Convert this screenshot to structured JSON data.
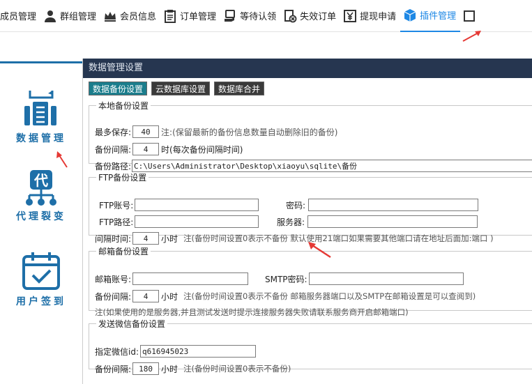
{
  "menu": [
    {
      "label": "成员管理",
      "icon": "user-icon"
    },
    {
      "label": "群组管理",
      "icon": "group-icon"
    },
    {
      "label": "会员信息",
      "icon": "crown-icon"
    },
    {
      "label": "订单管理",
      "icon": "clipboard-icon"
    },
    {
      "label": "等待认领",
      "icon": "hand-icon"
    },
    {
      "label": "失效订单",
      "icon": "invalid-order-icon"
    },
    {
      "label": "提现申请",
      "icon": "yen-icon"
    },
    {
      "label": "插件管理",
      "icon": "cube-icon"
    }
  ],
  "leftnav": [
    {
      "label": "数据管理",
      "icon": "data-management-icon"
    },
    {
      "label": "代理裂变",
      "icon": "agent-split-icon"
    },
    {
      "label": "用户签到",
      "icon": "calendar-check-icon"
    }
  ],
  "panel": {
    "title": "数据管理设置",
    "tabs": [
      "数据备份设置",
      "云数据库设置",
      "数据库合并"
    ]
  },
  "local": {
    "legend": "本地备份设置",
    "max_label": "最多保存:",
    "max_value": "40",
    "max_note": "注:(保留最新的备份信息数量自动删除旧的备份)",
    "interval_label": "备份间隔:",
    "interval_value": "4",
    "interval_note": "时(每次备份间隔时间)",
    "path_label": "备份路径:",
    "path_value": "C:\\Users\\Administrator\\Desktop\\xiaoyu\\sqlite\\备份"
  },
  "ftp": {
    "legend": "FTP备份设置",
    "account_label": "FTP账号:",
    "account_value": "",
    "password_label": "密码:",
    "password_value": "",
    "path_label": "FTP路径:",
    "path_value": "",
    "server_label": "服务器:",
    "server_value": "",
    "interval_label": "间隔时间:",
    "interval_value": "4",
    "interval_unit": "小时",
    "interval_note": "注(备份时间设置0表示不备份 默认使用21端口如果需要其他端口请在地址后面加:端口 )"
  },
  "mail": {
    "legend": "邮箱备份设置",
    "account_label": "邮箱账号:",
    "account_value": "",
    "smtp_label": "SMTP密码:",
    "smtp_value": "",
    "interval_label": "备份间隔:",
    "interval_value": "4",
    "interval_unit": "小时",
    "interval_note": "注(备份时间设置0表示不备份 邮箱服务器端口以及SMTP在邮箱设置是可以查阅到)",
    "note2": "注(如果使用的是服务器,并且测试发送时提示连接服务器失败请联系服务商开启邮箱端口)"
  },
  "wechat": {
    "legend": "发送微信备份设置",
    "id_label": "指定微信id:",
    "id_value": "q616945023",
    "interval_label": "备份间隔:",
    "interval_value": "180",
    "interval_unit": "小时",
    "interval_note": "注(备份时间设置0表示不备份)"
  },
  "colors": {
    "accent": "#1e88e5",
    "nav": "#1e6fa8",
    "header": "#263650",
    "tab_active": "#1b7d8c",
    "arrow": "#e53935"
  }
}
